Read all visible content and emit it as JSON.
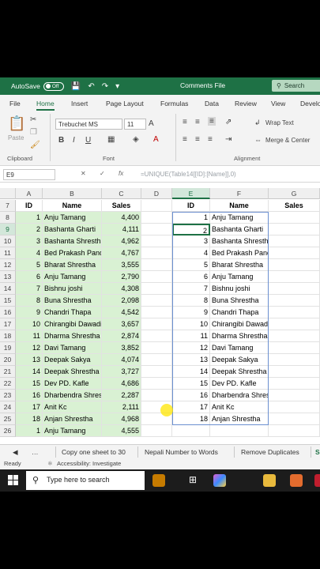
{
  "titlebar": {
    "autosave": "AutoSave",
    "toggle": "Off",
    "title": "Comments File",
    "search": "Search"
  },
  "menu": [
    "File",
    "Home",
    "Insert",
    "Page Layout",
    "Formulas",
    "Data",
    "Review",
    "View",
    "Develo"
  ],
  "ribbon": {
    "paste": "Paste",
    "clipboard": "Clipboard",
    "font_name": "Trebuchet MS",
    "font_size": "11",
    "font_group": "Font",
    "bold": "B",
    "italic": "I",
    "underline": "U",
    "wrap_text": "Wrap Text",
    "merge_center": "Merge & Center",
    "alignment": "Alignment"
  },
  "formula_bar": {
    "name_box": "E9",
    "formula": "=UNIQUE(Table14[[ID]:[Name]],0)"
  },
  "columns": [
    "A",
    "B",
    "C",
    "D",
    "E",
    "F",
    "G"
  ],
  "rows": [
    "7",
    "8",
    "9",
    "10",
    "11",
    "12",
    "13",
    "14",
    "15",
    "16",
    "17",
    "18",
    "19",
    "20",
    "21",
    "22",
    "23",
    "24",
    "25",
    "26"
  ],
  "table_left": {
    "headers": [
      "ID",
      "Name",
      "Sales"
    ],
    "rows": [
      [
        "1",
        "Anju Tamang",
        "4,400"
      ],
      [
        "2",
        "Bashanta Gharti",
        "4,111"
      ],
      [
        "3",
        "Bashanta Shrestha",
        "4,962"
      ],
      [
        "4",
        "Bed Prakash Pande",
        "4,767"
      ],
      [
        "5",
        "Bharat Shrestha",
        "3,555"
      ],
      [
        "6",
        "Anju Tamang",
        "2,790"
      ],
      [
        "7",
        "Bishnu joshi",
        "4,308"
      ],
      [
        "8",
        "Buna Shrestha",
        "2,098"
      ],
      [
        "9",
        "Chandri Thapa",
        "4,542"
      ],
      [
        "10",
        "Chirangibi Dawadi",
        "3,657"
      ],
      [
        "11",
        "Dharma Shrestha",
        "2,874"
      ],
      [
        "12",
        "Davi Tamang",
        "3,852"
      ],
      [
        "13",
        "Deepak Sakya",
        "4,074"
      ],
      [
        "14",
        "Deepak Shrestha",
        "3,727"
      ],
      [
        "15",
        "Dev PD. Kafle",
        "4,686"
      ],
      [
        "16",
        "Dharbendra Shrestha",
        "2,287"
      ],
      [
        "17",
        "Anit Kc",
        "2,111"
      ],
      [
        "18",
        "Anjan Shrestha",
        "4,968"
      ],
      [
        "1",
        "Anju Tamang",
        "4,555"
      ]
    ]
  },
  "table_right": {
    "headers": [
      "ID",
      "Name",
      "Sales"
    ],
    "rows": [
      [
        "1",
        "Anju Tamang"
      ],
      [
        "2",
        "Bashanta Gharti"
      ],
      [
        "3",
        "Bashanta Shrestha"
      ],
      [
        "4",
        "Bed Prakash Pande"
      ],
      [
        "5",
        "Bharat Shrestha"
      ],
      [
        "6",
        "Anju Tamang"
      ],
      [
        "7",
        "Bishnu joshi"
      ],
      [
        "8",
        "Buna Shrestha"
      ],
      [
        "9",
        "Chandri Thapa"
      ],
      [
        "10",
        "Chirangibi Dawadi"
      ],
      [
        "11",
        "Dharma Shrestha"
      ],
      [
        "12",
        "Davi Tamang"
      ],
      [
        "13",
        "Deepak Sakya"
      ],
      [
        "14",
        "Deepak Shrestha"
      ],
      [
        "15",
        "Dev PD. Kafle"
      ],
      [
        "16",
        "Dharbendra Shrestha"
      ],
      [
        "17",
        "Anit Kc"
      ],
      [
        "18",
        "Anjan Shrestha"
      ]
    ]
  },
  "sheet_tabs": [
    "Copy one sheet to 30",
    "Nepali Number to Words",
    "Remove Duplicates",
    "S"
  ],
  "status": {
    "ready": "Ready",
    "accessibility": "Accessibility: Investigate"
  },
  "taskbar": {
    "search_placeholder": "Type here to search"
  },
  "colors": {
    "excel_green": "#1e7145",
    "table_fill": "#d9f1d3"
  }
}
